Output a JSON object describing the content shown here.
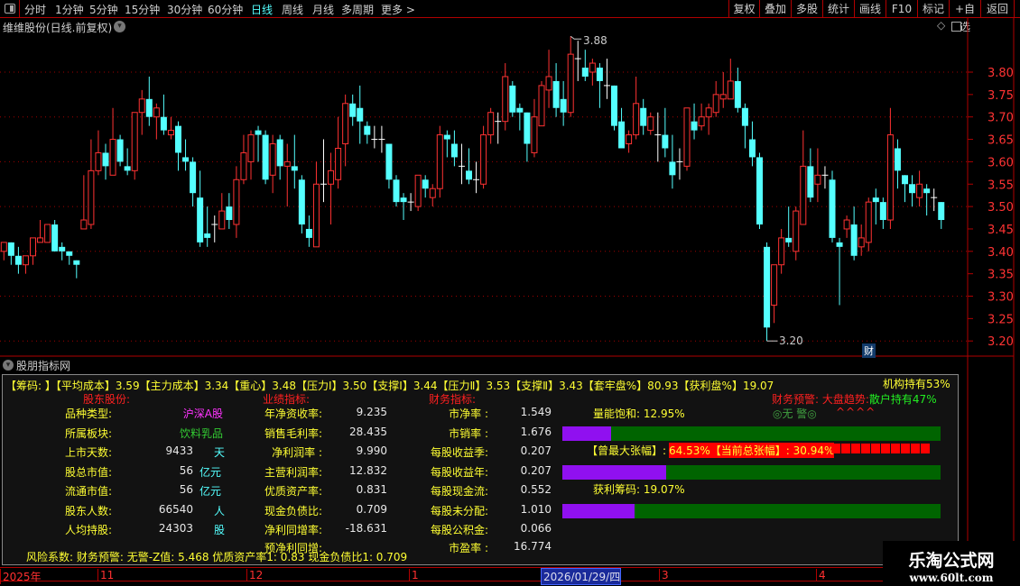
{
  "toolbar": {
    "periods": [
      "分时",
      "1分钟",
      "5分钟",
      "15分钟",
      "30分钟",
      "60分钟",
      "日线",
      "周线",
      "月线",
      "多周期",
      "更多 >"
    ],
    "active_index": 6,
    "right_buttons": [
      "复权",
      "叠加",
      "多股",
      "统计",
      "画线",
      "F10",
      "标记",
      "+自选",
      "返回"
    ]
  },
  "chart_header": {
    "title": "维维股份(日线.前复权)"
  },
  "price_axis": {
    "labels": [
      "3.80",
      "3.75",
      "3.70",
      "3.65",
      "3.60",
      "3.55",
      "3.50",
      "3.45",
      "3.40",
      "3.35",
      "3.30",
      "3.25",
      "3.20"
    ]
  },
  "chart_data": {
    "type": "candlestick",
    "ylim": [
      3.2,
      3.8
    ],
    "high_marker": "3.88",
    "low_marker": "3.20",
    "high_index": 78,
    "low_index": 105,
    "badge": "财",
    "ohlc": [
      [
        3.4,
        3.42,
        3.38,
        3.42
      ],
      [
        3.42,
        3.42,
        3.37,
        3.39
      ],
      [
        3.39,
        3.41,
        3.35,
        3.37
      ],
      [
        3.37,
        3.39,
        3.35,
        3.39
      ],
      [
        3.39,
        3.43,
        3.37,
        3.43
      ],
      [
        3.42,
        3.47,
        3.42,
        3.43
      ],
      [
        3.42,
        3.46,
        3.42,
        3.46
      ],
      [
        3.46,
        3.47,
        3.4,
        3.4
      ],
      [
        3.41,
        3.42,
        3.38,
        3.4
      ],
      [
        3.4,
        3.4,
        3.37,
        3.39
      ],
      [
        3.38,
        3.38,
        3.34,
        3.37
      ],
      [
        3.45,
        3.57,
        3.45,
        3.47
      ],
      [
        3.46,
        3.65,
        3.45,
        3.58
      ],
      [
        3.58,
        3.67,
        3.57,
        3.62
      ],
      [
        3.62,
        3.64,
        3.56,
        3.59
      ],
      [
        3.57,
        3.72,
        3.57,
        3.65
      ],
      [
        3.65,
        3.66,
        3.59,
        3.6
      ],
      [
        3.59,
        3.63,
        3.57,
        3.58
      ],
      [
        3.58,
        3.71,
        3.56,
        3.71
      ],
      [
        3.71,
        3.76,
        3.66,
        3.74
      ],
      [
        3.74,
        3.79,
        3.68,
        3.7
      ],
      [
        3.7,
        3.73,
        3.65,
        3.72
      ],
      [
        3.7,
        3.75,
        3.66,
        3.67
      ],
      [
        3.66,
        3.7,
        3.65,
        3.67
      ],
      [
        3.68,
        3.69,
        3.58,
        3.62
      ],
      [
        3.61,
        3.65,
        3.58,
        3.6
      ],
      [
        3.6,
        3.61,
        3.5,
        3.53
      ],
      [
        3.52,
        3.58,
        3.41,
        3.42
      ],
      [
        3.44,
        3.5,
        3.41,
        3.43
      ],
      [
        3.46,
        3.48,
        3.42,
        3.46
      ],
      [
        3.45,
        3.53,
        3.45,
        3.49
      ],
      [
        3.5,
        3.53,
        3.45,
        3.47
      ],
      [
        3.46,
        3.59,
        3.43,
        3.56
      ],
      [
        3.56,
        3.66,
        3.55,
        3.62
      ],
      [
        3.6,
        3.67,
        3.56,
        3.66
      ],
      [
        3.67,
        3.68,
        3.6,
        3.66
      ],
      [
        3.66,
        3.67,
        3.55,
        3.56
      ],
      [
        3.57,
        3.66,
        3.53,
        3.64
      ],
      [
        3.65,
        3.66,
        3.56,
        3.59
      ],
      [
        3.59,
        3.64,
        3.5,
        3.6
      ],
      [
        3.59,
        3.66,
        3.54,
        3.58
      ],
      [
        3.56,
        3.57,
        3.44,
        3.46
      ],
      [
        3.45,
        3.48,
        3.41,
        3.43
      ],
      [
        3.41,
        3.6,
        3.41,
        3.55
      ],
      [
        3.55,
        3.65,
        3.51,
        3.55
      ],
      [
        3.55,
        3.62,
        3.46,
        3.58
      ],
      [
        3.56,
        3.7,
        3.54,
        3.63
      ],
      [
        3.64,
        3.75,
        3.59,
        3.73
      ],
      [
        3.73,
        3.75,
        3.68,
        3.7
      ],
      [
        3.72,
        3.77,
        3.64,
        3.69
      ],
      [
        3.68,
        3.69,
        3.64,
        3.66
      ],
      [
        3.65,
        3.68,
        3.63,
        3.65
      ],
      [
        3.65,
        3.68,
        3.62,
        3.65
      ],
      [
        3.64,
        3.64,
        3.54,
        3.56
      ],
      [
        3.56,
        3.57,
        3.5,
        3.51
      ],
      [
        3.52,
        3.53,
        3.47,
        3.51
      ],
      [
        3.51,
        3.53,
        3.49,
        3.51
      ],
      [
        3.5,
        3.57,
        3.49,
        3.57
      ],
      [
        3.56,
        3.57,
        3.52,
        3.54
      ],
      [
        3.52,
        3.55,
        3.5,
        3.54
      ],
      [
        3.54,
        3.68,
        3.52,
        3.66
      ],
      [
        3.66,
        3.67,
        3.61,
        3.65
      ],
      [
        3.64,
        3.67,
        3.59,
        3.61
      ],
      [
        3.59,
        3.64,
        3.55,
        3.59
      ],
      [
        3.58,
        3.63,
        3.55,
        3.56
      ],
      [
        3.56,
        3.6,
        3.53,
        3.56
      ],
      [
        3.55,
        3.68,
        3.54,
        3.66
      ],
      [
        3.66,
        3.72,
        3.64,
        3.71
      ],
      [
        3.69,
        3.71,
        3.64,
        3.69
      ],
      [
        3.69,
        3.82,
        3.67,
        3.79
      ],
      [
        3.77,
        3.78,
        3.7,
        3.71
      ],
      [
        3.72,
        3.73,
        3.67,
        3.71
      ],
      [
        3.71,
        3.71,
        3.6,
        3.64
      ],
      [
        3.62,
        3.74,
        3.61,
        3.7
      ],
      [
        3.68,
        3.78,
        3.68,
        3.77
      ],
      [
        3.76,
        3.85,
        3.72,
        3.79
      ],
      [
        3.78,
        3.82,
        3.7,
        3.72
      ],
      [
        3.74,
        3.78,
        3.68,
        3.71
      ],
      [
        3.71,
        3.88,
        3.7,
        3.84
      ],
      [
        3.83,
        3.87,
        3.78,
        3.83
      ],
      [
        3.81,
        3.85,
        3.78,
        3.79
      ],
      [
        3.8,
        3.83,
        3.77,
        3.82
      ],
      [
        3.81,
        3.82,
        3.72,
        3.78
      ],
      [
        3.77,
        3.83,
        3.74,
        3.77
      ],
      [
        3.77,
        3.77,
        3.67,
        3.68
      ],
      [
        3.69,
        3.72,
        3.63,
        3.63
      ],
      [
        3.64,
        3.67,
        3.62,
        3.66
      ],
      [
        3.66,
        3.79,
        3.65,
        3.73
      ],
      [
        3.72,
        3.74,
        3.66,
        3.68
      ],
      [
        3.67,
        3.71,
        3.66,
        3.7
      ],
      [
        3.66,
        3.71,
        3.6,
        3.66
      ],
      [
        3.66,
        3.72,
        3.61,
        3.63
      ],
      [
        3.6,
        3.66,
        3.54,
        3.57
      ],
      [
        3.6,
        3.63,
        3.56,
        3.6
      ],
      [
        3.59,
        3.72,
        3.58,
        3.72
      ],
      [
        3.69,
        3.73,
        3.65,
        3.67
      ],
      [
        3.68,
        3.73,
        3.67,
        3.7
      ],
      [
        3.7,
        3.73,
        3.66,
        3.72
      ],
      [
        3.71,
        3.78,
        3.7,
        3.75
      ],
      [
        3.74,
        3.8,
        3.72,
        3.75
      ],
      [
        3.74,
        3.83,
        3.74,
        3.78
      ],
      [
        3.78,
        3.81,
        3.71,
        3.72
      ],
      [
        3.72,
        3.73,
        3.63,
        3.68
      ],
      [
        3.65,
        3.69,
        3.59,
        3.61
      ],
      [
        3.61,
        3.62,
        3.45,
        3.46
      ],
      [
        3.41,
        3.42,
        3.2,
        3.23
      ],
      [
        3.28,
        3.37,
        3.24,
        3.37
      ],
      [
        3.37,
        3.45,
        3.35,
        3.43
      ],
      [
        3.43,
        3.5,
        3.41,
        3.42
      ],
      [
        3.4,
        3.5,
        3.38,
        3.49
      ],
      [
        3.46,
        3.67,
        3.46,
        3.59
      ],
      [
        3.59,
        3.63,
        3.51,
        3.52
      ],
      [
        3.55,
        3.63,
        3.51,
        3.57
      ],
      [
        3.57,
        3.59,
        3.54,
        3.57
      ],
      [
        3.56,
        3.58,
        3.42,
        3.43
      ],
      [
        3.42,
        3.43,
        3.28,
        3.41
      ],
      [
        3.45,
        3.48,
        3.43,
        3.47
      ],
      [
        3.46,
        3.5,
        3.38,
        3.39
      ],
      [
        3.41,
        3.46,
        3.39,
        3.43
      ],
      [
        3.42,
        3.52,
        3.4,
        3.51
      ],
      [
        3.52,
        3.54,
        3.46,
        3.51
      ],
      [
        3.51,
        3.52,
        3.45,
        3.47
      ],
      [
        3.47,
        3.72,
        3.45,
        3.66
      ],
      [
        3.63,
        3.65,
        3.54,
        3.58
      ],
      [
        3.57,
        3.57,
        3.51,
        3.55
      ],
      [
        3.55,
        3.57,
        3.5,
        3.53
      ],
      [
        3.52,
        3.58,
        3.5,
        3.55
      ],
      [
        3.54,
        3.55,
        3.48,
        3.53
      ],
      [
        3.52,
        3.54,
        3.49,
        3.52
      ],
      [
        3.51,
        3.51,
        3.45,
        3.47
      ]
    ]
  },
  "indicator_panel": {
    "title": "股朋指标网",
    "chip_line": "【筹码: 】【平均成本】3.59【主力成本】3.34【重心】3.48【压力Ⅰ】3.50【支撑Ⅰ】3.44【压力Ⅱ】3.53【支撑Ⅱ】3.43【套牢盘%】80.93【获利盘%】19.07",
    "institution": "机构持有53%",
    "sections": [
      "股东股份:",
      "业绩指标:",
      "财务指标:"
    ],
    "col1": [
      {
        "label": "品种类型:",
        "value": "沪深A股",
        "unit": ""
      },
      {
        "label": "所属板块:",
        "value": "饮料乳品",
        "unit": ""
      },
      {
        "label": "上市天数:",
        "value": "9433",
        "unit": "天"
      },
      {
        "label": "股总市值:",
        "value": "56",
        "unit": "亿元"
      },
      {
        "label": "流通市值:",
        "value": "56",
        "unit": "亿元"
      },
      {
        "label": "股东人数:",
        "value": "66540",
        "unit": "人"
      },
      {
        "label": "人均持股:",
        "value": "24303",
        "unit": "股"
      }
    ],
    "col2": [
      {
        "label": "年净资收率:",
        "value": "9.235"
      },
      {
        "label": "销售毛利率:",
        "value": "28.435"
      },
      {
        "label": "净利润率 :",
        "value": "9.990"
      },
      {
        "label": "主营利润率:",
        "value": "12.832"
      },
      {
        "label": "优质资产率:",
        "value": "0.831"
      },
      {
        "label": "现金负债比:",
        "value": "0.709"
      },
      {
        "label": "净利同增率:",
        "value": "-18.631"
      },
      {
        "label": "预净利同增:",
        "value": ""
      }
    ],
    "col3": [
      {
        "label": "市净率 :",
        "value": "1.549"
      },
      {
        "label": "市销率 :",
        "value": "1.676"
      },
      {
        "label": "每股收益季:",
        "value": "0.207"
      },
      {
        "label": "每股收益年:",
        "value": "0.207"
      },
      {
        "label": "每股现金流:",
        "value": "0.552"
      },
      {
        "label": "每股未分配:",
        "value": "1.010"
      },
      {
        "label": "每股公积金:",
        "value": "0.066"
      },
      {
        "label": "市盈率 :",
        "value": "16.774"
      }
    ],
    "warn_label": "财务预警:",
    "trend_label": "大盘趋势:",
    "retail": "散户持有47%",
    "volume_sat": "量能饱和: 12.95%",
    "warn_value": "◎无 警◎",
    "trend_value": "^^^^",
    "max_rise_label": "【曾最大张幅】:",
    "max_rise_value": "64.53%【当前总张幅】: 30.94%",
    "profit_chips": "获利筹码: 19.07%",
    "bars": [
      {
        "fill_pct": 12.95
      },
      {
        "fill_pct": 27.4
      },
      {
        "fill_pct": 19.07
      }
    ],
    "risk_line": "风险系数: 财务预警: 无警-Z值: 5.468 优质资产率1: 0.83 现金负债比1: 0.709"
  },
  "date_axis": {
    "labels": [
      "2025年",
      "11",
      "12",
      "1",
      "2026/01/29/四",
      "3",
      "4"
    ]
  },
  "watermark": {
    "name": "乐淘公式网",
    "url": "www.60lt.com"
  },
  "colors": {
    "up": "#ff3232",
    "down": "#54ffff",
    "flat": "#ffffff",
    "grid": "#b00000"
  }
}
